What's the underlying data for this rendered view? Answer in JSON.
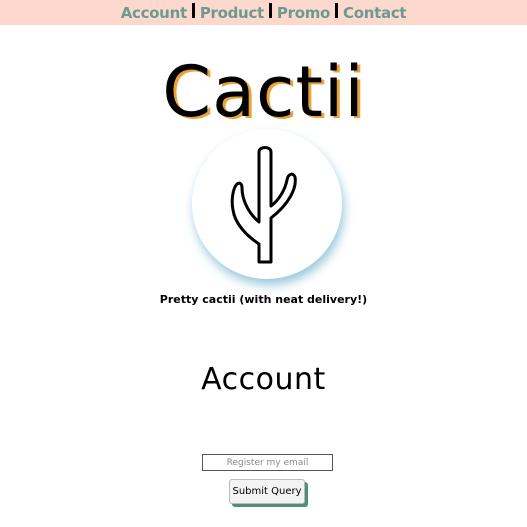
{
  "nav": {
    "items": [
      {
        "label": "Account"
      },
      {
        "label": "Product"
      },
      {
        "label": "Promo"
      },
      {
        "label": "Contact"
      }
    ]
  },
  "brand": {
    "title": "Cactii",
    "tagline": "Pretty cactii (with neat delivery!)",
    "logo_icon": "cactus-icon"
  },
  "section": {
    "title": "Account"
  },
  "form": {
    "email_placeholder": "Register my email",
    "submit_label": "Submit Query"
  },
  "colors": {
    "nav_background": "#fcd9cc",
    "nav_link": "#6c9a8f",
    "title_shadow": "#e8a43a",
    "button_shadow": "#4f8e7a",
    "circle_shadow": "#64aac8"
  }
}
